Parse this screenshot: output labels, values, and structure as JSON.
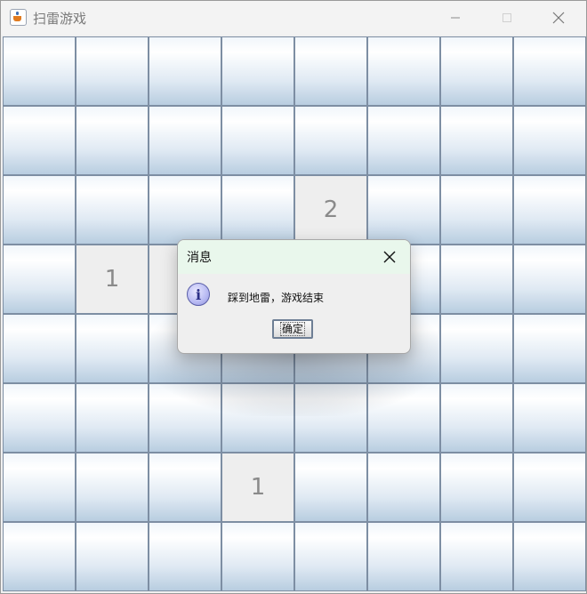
{
  "window": {
    "title": "扫雷游戏",
    "app_icon": "java-cup-icon",
    "controls": {
      "minimize": "minimize-icon",
      "maximize": "maximize-icon",
      "close": "close-icon"
    }
  },
  "board": {
    "rows": 8,
    "cols": 8,
    "cells": [
      [
        "",
        "",
        "",
        "",
        "",
        "",
        "",
        ""
      ],
      [
        "",
        "",
        "",
        "",
        "",
        "",
        "",
        ""
      ],
      [
        "",
        "",
        "",
        "",
        "2",
        "",
        "",
        ""
      ],
      [
        "",
        "1",
        "",
        "",
        "",
        "",
        "",
        ""
      ],
      [
        "",
        "",
        "",
        "",
        "",
        "",
        "",
        ""
      ],
      [
        "",
        "",
        "",
        "",
        "",
        "",
        "",
        ""
      ],
      [
        "",
        "",
        "",
        "1",
        "",
        "",
        "",
        ""
      ],
      [
        "",
        "",
        "",
        "",
        "",
        "",
        "",
        ""
      ]
    ],
    "revealed": [
      [
        2,
        4
      ],
      [
        3,
        1
      ],
      [
        3,
        2
      ],
      [
        6,
        3
      ]
    ]
  },
  "dialog": {
    "title": "消息",
    "message": "踩到地雷，游戏结束",
    "ok_label": "确定",
    "icon": "info-icon"
  },
  "colors": {
    "cell_border": "#7d8ea3",
    "revealed_cell": "#eeeeee",
    "dialog_header": "#e9f7ec",
    "number_text": "#8a8a8a"
  }
}
